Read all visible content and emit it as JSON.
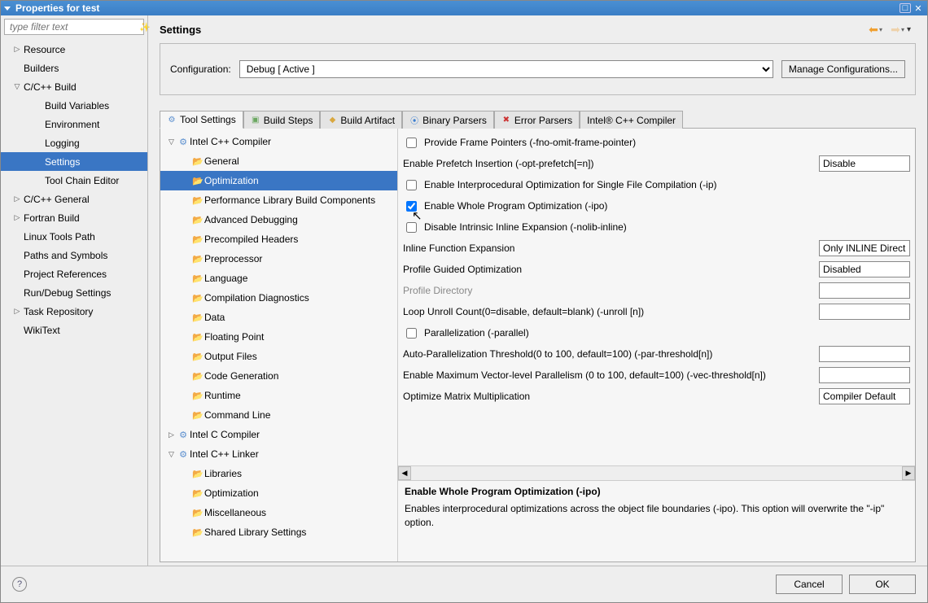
{
  "window": {
    "title": "Properties for test"
  },
  "filter": {
    "placeholder": "type filter text"
  },
  "nav": [
    {
      "label": "Resource",
      "expand": "▷",
      "depth": 0
    },
    {
      "label": "Builders",
      "expand": "",
      "depth": 0
    },
    {
      "label": "C/C++ Build",
      "expand": "▽",
      "depth": 0
    },
    {
      "label": "Build Variables",
      "expand": "",
      "depth": 1
    },
    {
      "label": "Environment",
      "expand": "",
      "depth": 1
    },
    {
      "label": "Logging",
      "expand": "",
      "depth": 1
    },
    {
      "label": "Settings",
      "expand": "",
      "depth": 1,
      "selected": true
    },
    {
      "label": "Tool Chain Editor",
      "expand": "",
      "depth": 1
    },
    {
      "label": "C/C++ General",
      "expand": "▷",
      "depth": 0
    },
    {
      "label": "Fortran Build",
      "expand": "▷",
      "depth": 0
    },
    {
      "label": "Linux Tools Path",
      "expand": "",
      "depth": 0
    },
    {
      "label": "Paths and Symbols",
      "expand": "",
      "depth": 0
    },
    {
      "label": "Project References",
      "expand": "",
      "depth": 0
    },
    {
      "label": "Run/Debug Settings",
      "expand": "",
      "depth": 0
    },
    {
      "label": "Task Repository",
      "expand": "▷",
      "depth": 0
    },
    {
      "label": "WikiText",
      "expand": "",
      "depth": 0
    }
  ],
  "header": {
    "title": "Settings"
  },
  "config": {
    "label": "Configuration:",
    "value": "Debug  [ Active ]",
    "manage": "Manage Configurations..."
  },
  "tabs": [
    {
      "label": "Tool Settings",
      "iconClass": "ts",
      "active": true
    },
    {
      "label": "Build Steps",
      "iconClass": "bs"
    },
    {
      "label": "Build Artifact",
      "iconClass": "ba"
    },
    {
      "label": "Binary Parsers",
      "iconClass": "bp"
    },
    {
      "label": "Error Parsers",
      "iconClass": "ep"
    },
    {
      "label": "Intel® C++ Compiler",
      "iconClass": ""
    }
  ],
  "toolTree": [
    {
      "label": "Intel C++ Compiler",
      "expand": "▽",
      "depth": 0,
      "icon": "⚙"
    },
    {
      "label": "General",
      "depth": 1,
      "icon": "f"
    },
    {
      "label": "Optimization",
      "depth": 1,
      "icon": "f",
      "selected": true
    },
    {
      "label": "Performance Library Build Components",
      "depth": 1,
      "icon": "f"
    },
    {
      "label": "Advanced Debugging",
      "depth": 1,
      "icon": "f"
    },
    {
      "label": "Precompiled Headers",
      "depth": 1,
      "icon": "f"
    },
    {
      "label": "Preprocessor",
      "depth": 1,
      "icon": "f"
    },
    {
      "label": "Language",
      "depth": 1,
      "icon": "f"
    },
    {
      "label": "Compilation Diagnostics",
      "depth": 1,
      "icon": "f"
    },
    {
      "label": "Data",
      "depth": 1,
      "icon": "f"
    },
    {
      "label": "Floating Point",
      "depth": 1,
      "icon": "f"
    },
    {
      "label": "Output Files",
      "depth": 1,
      "icon": "f"
    },
    {
      "label": "Code Generation",
      "depth": 1,
      "icon": "f"
    },
    {
      "label": "Runtime",
      "depth": 1,
      "icon": "f"
    },
    {
      "label": "Command Line",
      "depth": 1,
      "icon": "f"
    },
    {
      "label": "Intel C Compiler",
      "expand": "▷",
      "depth": 0,
      "icon": "⚙"
    },
    {
      "label": "Intel C++ Linker",
      "expand": "▽",
      "depth": 0,
      "icon": "⚙"
    },
    {
      "label": "Libraries",
      "depth": 1,
      "icon": "f"
    },
    {
      "label": "Optimization",
      "depth": 1,
      "icon": "f"
    },
    {
      "label": "Miscellaneous",
      "depth": 1,
      "icon": "f"
    },
    {
      "label": "Shared Library Settings",
      "depth": 1,
      "icon": "f"
    }
  ],
  "form": [
    {
      "type": "check",
      "name": "Provide Frame Pointers (-fno-omit-frame-pointer)",
      "checked": false
    },
    {
      "type": "comboRow",
      "name": "Enable Prefetch Insertion (-opt-prefetch[=n])",
      "value": "Disable"
    },
    {
      "type": "check",
      "name": "Enable Interprocedural Optimization for Single File Compilation (-ip)",
      "checked": false
    },
    {
      "type": "check",
      "name": "Enable Whole Program Optimization (-ipo)",
      "checked": true
    },
    {
      "type": "check",
      "name": "Disable Intrinsic Inline Expansion (-nolib-inline)",
      "checked": false
    },
    {
      "type": "comboRow",
      "name": "Inline Function Expansion",
      "value": "Only INLINE Direct"
    },
    {
      "type": "comboRow",
      "name": "Profile Guided Optimization",
      "value": "Disabled"
    },
    {
      "type": "textRow",
      "name": "Profile Directory",
      "dim": true,
      "value": ""
    },
    {
      "type": "textRow",
      "name": "Loop Unroll Count(0=disable, default=blank) (-unroll [n])",
      "value": ""
    },
    {
      "type": "check",
      "name": "Parallelization (-parallel)",
      "checked": false
    },
    {
      "type": "textRow",
      "name": "Auto-Parallelization Threshold(0 to 100, default=100) (-par-threshold[n])",
      "value": ""
    },
    {
      "type": "textRow",
      "name": "Enable Maximum Vector-level Parallelism (0 to 100, default=100) (-vec-threshold[n])",
      "value": ""
    },
    {
      "type": "comboRow",
      "name": "Optimize Matrix Multiplication",
      "value": "Compiler Default"
    }
  ],
  "desc": {
    "title": "Enable Whole Program Optimization (-ipo)",
    "body": "Enables interprocedural optimizations across the object file boundaries (-ipo). This option will overwrite the \"-ip\" option."
  },
  "buttons": {
    "cancel": "Cancel",
    "ok": "OK"
  }
}
